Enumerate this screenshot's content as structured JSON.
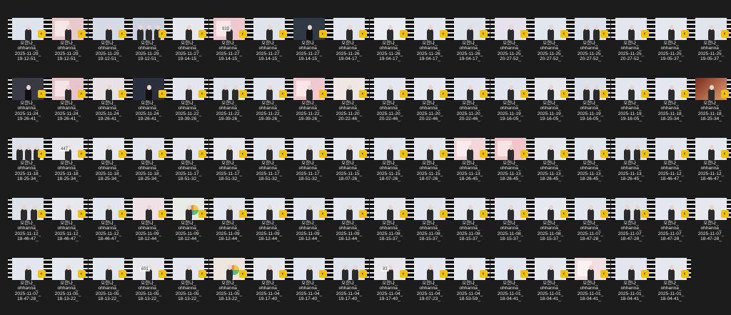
{
  "window": {
    "title": ""
  },
  "files": [
    {
      "name": "오한나_ ohhanna_ 2025-11-29_ 19-12-51_",
      "l1": "오한나_",
      "l2": "ohhanna_",
      "l3": "2025-11-29_",
      "l4": "19-12-51_",
      "thumb": "light",
      "bg": "#dde4ee"
    },
    {
      "name": "",
      "l1": "오한나_",
      "l2": "ohhanna_",
      "l3": "2025-11-29_",
      "l4": "19-12-51_",
      "thumb": "pinkpanel",
      "bg": "#e9c9cc"
    },
    {
      "name": "",
      "l1": "오한나_",
      "l2": "ohhanna_",
      "l3": "2025-11-29_",
      "l4": "19-12-51_",
      "thumb": "light",
      "bg": "#d5dbe6"
    },
    {
      "name": "",
      "l1": "오한나_",
      "l2": "ohhanna_",
      "l3": "2025-11-29_",
      "l4": "19-12-51_",
      "thumb": "group",
      "bg": "#c9d2de"
    },
    {
      "name": "",
      "l1": "오한나_",
      "l2": "ohhanna_",
      "l3": "2025-11-27_",
      "l4": "19-14-15_",
      "thumb": "light",
      "bg": "#e7e7ee"
    },
    {
      "name": "",
      "l1": "오한나_",
      "l2": "ohhanna_",
      "l3": "2025-11-27_",
      "l4": "19-14-15_",
      "thumb": "pinkpanel",
      "bg": "#efc7cf",
      "num": "939"
    },
    {
      "name": "",
      "l1": "오한나_",
      "l2": "ohhanna_",
      "l3": "2025-11-27_",
      "l4": "19-14-15_",
      "thumb": "light",
      "bg": "#dfe3ec"
    },
    {
      "name": "",
      "l1": "오한나_",
      "l2": "ohhanna_",
      "l3": "2025-11-27_",
      "l4": "19-14-15_",
      "thumb": "dark",
      "bg": "#2f3a45"
    },
    {
      "name": "",
      "l1": "오한나_",
      "l2": "ohhanna_",
      "l3": "2025-11-26_",
      "l4": "19-04-17_",
      "thumb": "light",
      "bg": "#e3e6ee"
    },
    {
      "name": "",
      "l1": "오한나_",
      "l2": "ohhanna_",
      "l3": "2025-11-26_",
      "l4": "19-04-17_",
      "thumb": "light",
      "bg": "#e9edf2"
    },
    {
      "name": "",
      "l1": "오한나_",
      "l2": "ohhanna_",
      "l3": "2025-11-26_",
      "l4": "19-04-17_",
      "thumb": "light",
      "bg": "#e4e7ef"
    },
    {
      "name": "",
      "l1": "오한나_",
      "l2": "ohhanna_",
      "l3": "2025-11-26_",
      "l4": "19-04-17_",
      "thumb": "light",
      "bg": "#dfe4ec"
    },
    {
      "name": "",
      "l1": "오한나_",
      "l2": "ohhanna_",
      "l3": "2025-11-25_",
      "l4": "20-27-52_",
      "thumb": "light",
      "bg": "#e6e2ec"
    },
    {
      "name": "",
      "l1": "오한나_",
      "l2": "ohhanna_",
      "l3": "2025-11-25_",
      "l4": "20-27-52_",
      "thumb": "light",
      "bg": "#e2e6ee"
    },
    {
      "name": "",
      "l1": "오한나_",
      "l2": "ohhanna_",
      "l3": "2025-11-25_",
      "l4": "20-27-52_",
      "thumb": "pair",
      "bg": "#dde3ec"
    },
    {
      "name": "",
      "l1": "오한나_",
      "l2": "ohhanna_",
      "l3": "2025-11-25_",
      "l4": "20-27-52_",
      "thumb": "light",
      "bg": "#e3e6ee"
    },
    {
      "name": "",
      "l1": "오한나_",
      "l2": "ohhanna_",
      "l3": "2025-11-25_",
      "l4": "19-05-37_",
      "thumb": "light",
      "bg": "#e6e8ef"
    },
    {
      "name": "",
      "l1": "오한나_",
      "l2": "ohhanna_",
      "l3": "2025-11-25_",
      "l4": "19-05-37_",
      "thumb": "light",
      "bg": "#e0e4ec"
    },
    {
      "name": "",
      "l1": "오한나_",
      "l2": "ohhanna_",
      "l3": "2025-11-24_",
      "l4": "19-26-41_",
      "thumb": "dark",
      "bg": "#3a3a46"
    },
    {
      "name": "",
      "l1": "오한나_",
      "l2": "ohhanna_",
      "l3": "2025-11-24_",
      "l4": "19-26-41_",
      "thumb": "pinkpanel",
      "bg": "#e7c3cc"
    },
    {
      "name": "",
      "l1": "오한나_",
      "l2": "ohhanna_",
      "l3": "2025-11-24_",
      "l4": "19-26-41_",
      "thumb": "light",
      "bg": "#e8e1e6"
    },
    {
      "name": "",
      "l1": "오한나_",
      "l2": "ohhanna_",
      "l3": "2025-11-24_",
      "l4": "19-26-41_",
      "thumb": "dark",
      "bg": "#2b2f3d"
    },
    {
      "name": "",
      "l1": "오한나_",
      "l2": "ohhanna_",
      "l3": "2025-11-22_",
      "l4": "19-39-26_",
      "thumb": "light",
      "bg": "#e3e6ee"
    },
    {
      "name": "",
      "l1": "오한나_",
      "l2": "ohhanna_",
      "l3": "2025-11-22_",
      "l4": "19-39-26_",
      "thumb": "pair",
      "bg": "#dfe3ec"
    },
    {
      "name": "",
      "l1": "오한나_",
      "l2": "ohhanna_",
      "l3": "2025-11-22_",
      "l4": "19-39-26_",
      "thumb": "light",
      "bg": "#e2e5ee"
    },
    {
      "name": "",
      "l1": "오한나_",
      "l2": "ohhanna_",
      "l3": "2025-11-22_",
      "l4": "19-39-26_",
      "thumb": "pinkpanel",
      "bg": "#f0c8cf"
    },
    {
      "name": "",
      "l1": "오한나_",
      "l2": "ohhanna_",
      "l3": "2025-11-20_",
      "l4": "20-22-46_",
      "thumb": "light",
      "bg": "#efe6e6"
    },
    {
      "name": "",
      "l1": "오한나_",
      "l2": "ohhanna_",
      "l3": "2025-11-20_",
      "l4": "20-22-46_",
      "thumb": "light",
      "bg": "#e4e7ef"
    },
    {
      "name": "",
      "l1": "오한나_",
      "l2": "ohhanna_",
      "l3": "2025-11-20_",
      "l4": "20-22-46_",
      "thumb": "light",
      "bg": "#e6e9ef"
    },
    {
      "name": "",
      "l1": "오한나_",
      "l2": "ohhanna_",
      "l3": "2025-11-20_",
      "l4": "20-22-46_",
      "thumb": "light",
      "bg": "#e3e6ee"
    },
    {
      "name": "",
      "l1": "오한나_",
      "l2": "ohhanna_",
      "l3": "2025-11-19_",
      "l4": "19-16-05_",
      "thumb": "light",
      "bg": "#e1e5ed"
    },
    {
      "name": "",
      "l1": "오한나_",
      "l2": "ohhanna_",
      "l3": "2025-11-19_",
      "l4": "19-16-05_",
      "thumb": "light",
      "bg": "#e6e8ee"
    },
    {
      "name": "",
      "l1": "오한나_",
      "l2": "ohhanna_",
      "l3": "2025-11-19_",
      "l4": "19-16-05_",
      "thumb": "pair",
      "bg": "#dde2ea"
    },
    {
      "name": "",
      "l1": "오한나_",
      "l2": "ohhanna_",
      "l3": "2025-11-19_",
      "l4": "19-16-05_",
      "thumb": "light",
      "bg": "#e2e6ee"
    },
    {
      "name": "",
      "l1": "오한나_",
      "l2": "ohhanna_",
      "l3": "2025-11-18_",
      "l4": "18-25-34_",
      "thumb": "light",
      "bg": "#e4e7ef"
    },
    {
      "name": "",
      "l1": "오한나_",
      "l2": "ohhanna_",
      "l3": "2025-11-18_",
      "l4": "18-25-34_",
      "thumb": "warm",
      "bg": "#c97b5c"
    },
    {
      "name": "",
      "l1": "오한나_",
      "l2": "ohhanna_",
      "l3": "2025-11-18_",
      "l4": "18-25-34_",
      "thumb": "group",
      "bg": "#dde2ea"
    },
    {
      "name": "",
      "l1": "오한나_",
      "l2": "ohhanna_",
      "l3": "2025-11-18_",
      "l4": "18-25-34_",
      "thumb": "light",
      "bg": "#e7e7ec",
      "num": "447"
    },
    {
      "name": "",
      "l1": "오한나_",
      "l2": "ohhanna_",
      "l3": "2025-11-18_",
      "l4": "18-25-34_",
      "thumb": "light",
      "bg": "#e6e9ef"
    },
    {
      "name": "",
      "l1": "오한나_",
      "l2": "ohhanna_",
      "l3": "2025-11-18_",
      "l4": "18-25-34_",
      "thumb": "light",
      "bg": "#e2e5ee"
    },
    {
      "name": "",
      "l1": "오한나_",
      "l2": "ohhanna_",
      "l3": "2025-11-17_",
      "l4": "18-51-32_",
      "thumb": "light",
      "bg": "#e4e7ef"
    },
    {
      "name": "",
      "l1": "오한나_",
      "l2": "ohhanna_",
      "l3": "2025-11-17_",
      "l4": "18-51-32_",
      "thumb": "light",
      "bg": "#e7e9ef"
    },
    {
      "name": "",
      "l1": "오한나_",
      "l2": "ohhanna_",
      "l3": "2025-11-17_",
      "l4": "18-51-32_",
      "thumb": "light",
      "bg": "#e2e6ee"
    },
    {
      "name": "",
      "l1": "오한나_",
      "l2": "ohhanna_",
      "l3": "2025-11-17_",
      "l4": "18-51-32_",
      "thumb": "light",
      "bg": "#e5e8ef"
    },
    {
      "name": "",
      "l1": "오한나_",
      "l2": "ohhanna_",
      "l3": "2025-11-15_",
      "l4": "18-07-26_",
      "thumb": "light",
      "bg": "#e6e9ef"
    },
    {
      "name": "",
      "l1": "오한나_",
      "l2": "ohhanna_",
      "l3": "2025-11-15_",
      "l4": "18-07-26_",
      "thumb": "light",
      "bg": "#e2e6ee"
    },
    {
      "name": "",
      "l1": "오한나_",
      "l2": "ohhanna_",
      "l3": "2025-11-15_",
      "l4": "18-07-26_",
      "thumb": "light",
      "bg": "#e4e7ef"
    },
    {
      "name": "",
      "l1": "오한나_",
      "l2": "ohhanna_",
      "l3": "2025-11-13_",
      "l4": "18-26-45_",
      "thumb": "pinkpanel",
      "bg": "#f3d6da"
    },
    {
      "name": "",
      "l1": "오한나_",
      "l2": "ohhanna_",
      "l3": "2025-11-13_",
      "l4": "18-26-45_",
      "thumb": "pinkpanel",
      "bg": "#f0c4c8"
    },
    {
      "name": "",
      "l1": "오한나_",
      "l2": "ohhanna_",
      "l3": "2025-11-13_",
      "l4": "18-26-45_",
      "thumb": "light",
      "bg": "#e6e8ee"
    },
    {
      "name": "",
      "l1": "오한나_",
      "l2": "ohhanna_",
      "l3": "2025-11-13_",
      "l4": "18-26-45_",
      "thumb": "light",
      "bg": "#e2e6ee"
    },
    {
      "name": "",
      "l1": "오한나_",
      "l2": "ohhanna_",
      "l3": "2025-11-13_",
      "l4": "18-26-45_",
      "thumb": "pair",
      "bg": "#dfe3ec"
    },
    {
      "name": "",
      "l1": "오한나_",
      "l2": "ohhanna_",
      "l3": "2025-11-12_",
      "l4": "18-46-47_",
      "thumb": "light",
      "bg": "#e3e6ee"
    },
    {
      "name": "",
      "l1": "오한나_",
      "l2": "ohhanna_",
      "l3": "2025-11-12_",
      "l4": "18-46-47_",
      "thumb": "light",
      "bg": "#e5e8ef"
    },
    {
      "name": "",
      "l1": "오한나_",
      "l2": "ohhanna_",
      "l3": "2025-11-12_",
      "l4": "18-46-47_",
      "thumb": "pair",
      "bg": "#dde2ea"
    },
    {
      "name": "",
      "l1": "오한나_",
      "l2": "ohhanna_",
      "l3": "2025-11-12_",
      "l4": "18-46-47_",
      "thumb": "light",
      "bg": "#e6e8ee"
    },
    {
      "name": "",
      "l1": "오한나_",
      "l2": "ohhanna_",
      "l3": "2025-11-12_",
      "l4": "18-46-47_",
      "thumb": "light",
      "bg": "#e2e6ee"
    },
    {
      "name": "",
      "l1": "오한나_",
      "l2": "ohhanna_",
      "l3": "2025-11-09_",
      "l4": "18-12-44_",
      "thumb": "light",
      "bg": "#efe2e6"
    },
    {
      "name": "",
      "l1": "오한나_",
      "l2": "ohhanna_",
      "l3": "2025-11-09_",
      "l4": "18-12-44_",
      "thumb": "colorful",
      "bg": "#e9ebe6"
    },
    {
      "name": "",
      "l1": "오한나_",
      "l2": "ohhanna_",
      "l3": "2025-11-09_",
      "l4": "18-12-44_",
      "thumb": "light",
      "bg": "#e4e7ef"
    },
    {
      "name": "",
      "l1": "오한나_",
      "l2": "ohhanna_",
      "l3": "2025-11-09_",
      "l4": "18-12-44_",
      "thumb": "light",
      "bg": "#e6e9ef"
    },
    {
      "name": "",
      "l1": "오한나_",
      "l2": "ohhanna_",
      "l3": "2025-11-09_",
      "l4": "18-12-44_",
      "thumb": "light",
      "bg": "#e2e6ee"
    },
    {
      "name": "",
      "l1": "오한나_",
      "l2": "ohhanna_",
      "l3": "2025-11-09_",
      "l4": "18-12-44_",
      "thumb": "light",
      "bg": "#e4e7ef"
    },
    {
      "name": "",
      "l1": "오한나_",
      "l2": "ohhanna_",
      "l3": "2025-11-08_",
      "l4": "18-15-37_",
      "thumb": "light",
      "bg": "#e6e8ee"
    },
    {
      "name": "",
      "l1": "오한나_",
      "l2": "ohhanna_",
      "l3": "2025-11-08_",
      "l4": "18-15-37_",
      "thumb": "light",
      "bg": "#e2e6ee"
    },
    {
      "name": "",
      "l1": "오한나_",
      "l2": "ohhanna_",
      "l3": "2025-11-08_",
      "l4": "18-15-37_",
      "thumb": "light",
      "bg": "#e5e8ef"
    },
    {
      "name": "",
      "l1": "오한나_",
      "l2": "ohhanna_",
      "l3": "2025-11-08_",
      "l4": "18-15-37_",
      "thumb": "light",
      "bg": "#e3e6ee"
    },
    {
      "name": "",
      "l1": "오한나_",
      "l2": "ohhanna_",
      "l3": "2025-11-08_",
      "l4": "18-15-37_",
      "thumb": "light",
      "bg": "#e6e9ef"
    },
    {
      "name": "",
      "l1": "오한나_",
      "l2": "ohhanna_",
      "l3": "2025-11-07_",
      "l4": "18-47-28_",
      "thumb": "light",
      "bg": "#e2e6ee"
    },
    {
      "name": "",
      "l1": "오한나_",
      "l2": "ohhanna_",
      "l3": "2025-11-07_",
      "l4": "18-47-28_",
      "thumb": "pair",
      "bg": "#dfe3ec"
    },
    {
      "name": "",
      "l1": "오한나_",
      "l2": "ohhanna_",
      "l3": "2025-11-07_",
      "l4": "18-47-28_",
      "thumb": "light",
      "bg": "#e4e7ef"
    },
    {
      "name": "",
      "l1": "오한나_",
      "l2": "ohhanna_",
      "l3": "2025-11-07_",
      "l4": "18-47-28_",
      "thumb": "light",
      "bg": "#e6e8ee"
    },
    {
      "name": "",
      "l1": "오한나_",
      "l2": "ohhanna_",
      "l3": "2025-11-07_",
      "l4": "18-47-28_",
      "thumb": "light",
      "bg": "#e3e6ee"
    },
    {
      "name": "",
      "l1": "오한나_",
      "l2": "ohhanna_",
      "l3": "2025-11-05_",
      "l4": "18-13-22_",
      "thumb": "light",
      "bg": "#e5e8ef"
    },
    {
      "name": "",
      "l1": "오한나_",
      "l2": "ohhanna_",
      "l3": "2025-11-05_",
      "l4": "18-13-22_",
      "thumb": "light",
      "bg": "#e2e6ee"
    },
    {
      "name": "",
      "l1": "오한나_",
      "l2": "ohhanna_",
      "l3": "2025-11-05_",
      "l4": "18-13-22_",
      "thumb": "light",
      "bg": "#e7e7ec",
      "num": "691"
    },
    {
      "name": "",
      "l1": "오한나_",
      "l2": "ohhanna_",
      "l3": "2025-11-05_",
      "l4": "18-13-22_",
      "thumb": "light",
      "bg": "#e4e7ef"
    },
    {
      "name": "",
      "l1": "오한나_",
      "l2": "ohhanna_",
      "l3": "2025-11-05_",
      "l4": "18-13-22_",
      "thumb": "colorful",
      "bg": "#ece6df"
    },
    {
      "name": "",
      "l1": "오한나_",
      "l2": "ohhanna_",
      "l3": "2025-11-04_",
      "l4": "19-17-40_",
      "thumb": "light",
      "bg": "#e6e8ee"
    },
    {
      "name": "",
      "l1": "오한나_",
      "l2": "ohhanna_",
      "l3": "2025-11-04_",
      "l4": "19-17-40_",
      "thumb": "light",
      "bg": "#e2e6ee"
    },
    {
      "name": "",
      "l1": "오한나_",
      "l2": "ohhanna_",
      "l3": "2025-11-04_",
      "l4": "19-17-40_",
      "thumb": "pair",
      "bg": "#dfe3ec"
    },
    {
      "name": "",
      "l1": "오한나_",
      "l2": "ohhanna_",
      "l3": "2025-11-04_",
      "l4": "19-17-40_",
      "thumb": "light",
      "bg": "#e7e7ec",
      "num": "83"
    },
    {
      "name": "",
      "l1": "오한나_",
      "l2": "ohhanna_",
      "l3": "2025-11-04_",
      "l4": "19-07-23_",
      "thumb": "light",
      "bg": "#e4e7ef"
    },
    {
      "name": "",
      "l1": "오한나_",
      "l2": "ohhanna_",
      "l3": "2025-11-04_",
      "l4": "18-53-59_",
      "thumb": "light",
      "bg": "#e6e9ef"
    },
    {
      "name": "",
      "l1": "오한나_",
      "l2": "ohhanna_",
      "l3": "2025-11-01_",
      "l4": "18-04-41_",
      "thumb": "light",
      "bg": "#e2e6ee"
    },
    {
      "name": "",
      "l1": "오한나_",
      "l2": "ohhanna_",
      "l3": "2025-11-01_",
      "l4": "18-04-41_",
      "thumb": "light",
      "bg": "#e5e8ef"
    },
    {
      "name": "",
      "l1": "오한나_",
      "l2": "ohhanna_",
      "l3": "2025-11-01_",
      "l4": "18-04-41_",
      "thumb": "pinkpanel",
      "bg": "#f1dfe3"
    },
    {
      "name": "",
      "l1": "오한나_",
      "l2": "ohhanna_",
      "l3": "2025-11-01_",
      "l4": "18-04-41_",
      "thumb": "light",
      "bg": "#e3e6ee"
    },
    {
      "name": "",
      "l1": "오한나_",
      "l2": "ohhanna_",
      "l3": "2025-11-01_",
      "l4": "18-04-41_",
      "thumb": "light",
      "bg": "#e6e8ee"
    }
  ],
  "colors": {
    "background": "#1c1c1c",
    "badge": "#f2c300",
    "text": "#e6e6e6"
  },
  "icons": {
    "badge": "video-app-badge-icon",
    "filmstrip": "filmstrip-edge-icon"
  }
}
